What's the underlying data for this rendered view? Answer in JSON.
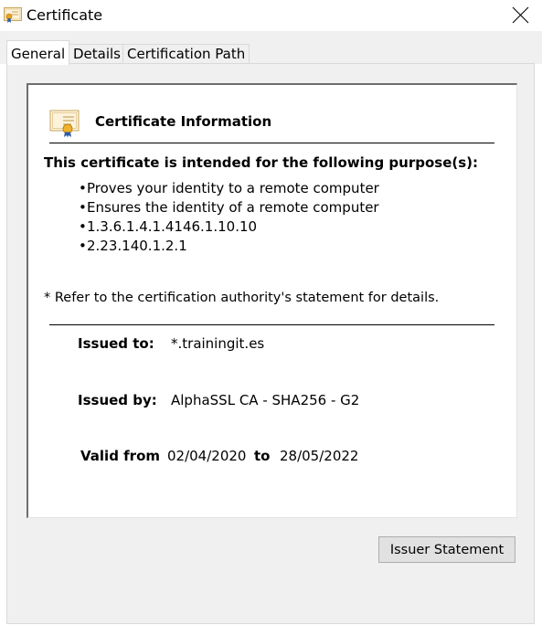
{
  "window": {
    "title": "Certificate",
    "title_icon": "certificate-icon",
    "close_icon": "close-icon"
  },
  "tabs": [
    {
      "label": "General",
      "active": true
    },
    {
      "label": "Details",
      "active": false
    },
    {
      "label": "Certification Path",
      "active": false
    }
  ],
  "general": {
    "info_icon": "certificate-icon",
    "info_title": "Certificate Information",
    "purpose_heading": "This certificate is intended for the following purpose(s):",
    "purposes": [
      "Proves your identity to a remote computer",
      "Ensures the identity of a remote computer",
      "1.3.6.1.4.1.4146.1.10.10",
      "2.23.140.1.2.1"
    ],
    "refer_note": "* Refer to the certification authority's statement for details.",
    "issued_to_label": "Issued to:",
    "issued_to_value": "*.trainingit.es",
    "issued_by_label": "Issued by:",
    "issued_by_value": "AlphaSSL CA - SHA256 - G2",
    "valid_from_label": "Valid from",
    "valid_from_value": "02/04/2020",
    "valid_to_label": "to",
    "valid_to_value": "28/05/2022"
  },
  "buttons": {
    "issuer_statement": "Issuer Statement"
  },
  "colors": {
    "dialog_bg": "#f0f0f0",
    "panel_bg": "#ffffff",
    "button_bg": "#e1e1e1"
  }
}
